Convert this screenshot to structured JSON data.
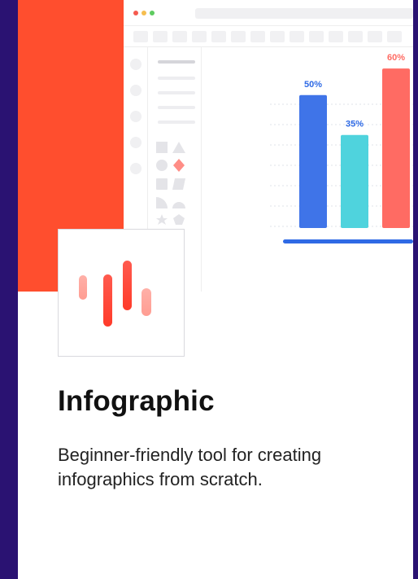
{
  "card": {
    "title": "Infographic",
    "description": "Beginner-friendly tool for creating infographics from scratch."
  },
  "icons": {
    "logo": "infographic-bars-icon",
    "traffic_lights": [
      "close-dot-icon",
      "minimize-dot-icon",
      "maximize-dot-icon"
    ],
    "shapes": [
      "square-icon",
      "triangle-icon",
      "circle-icon",
      "diamond-icon",
      "rounded-square-icon",
      "parallelogram-icon",
      "quarter-circle-icon",
      "semicircle-icon",
      "star-icon",
      "pentagon-icon"
    ]
  },
  "colors": {
    "background": "#2a1272",
    "accent": "#ff4e2e",
    "bar_blue": "#3f74e8",
    "bar_cyan": "#4fd3dd",
    "bar_red": "#ff6b63"
  },
  "chart_data": {
    "type": "bar",
    "categories": [
      "",
      "",
      ""
    ],
    "values": [
      50,
      35,
      60
    ],
    "labels": [
      "50%",
      "35%",
      "60%"
    ],
    "colors": [
      "#3f74e8",
      "#4fd3dd",
      "#ff6b63"
    ],
    "label_colors": [
      "#2f6ae5",
      "#2f6ae5",
      "#ff6b63"
    ],
    "ylim": [
      0,
      100
    ],
    "grid": true
  }
}
